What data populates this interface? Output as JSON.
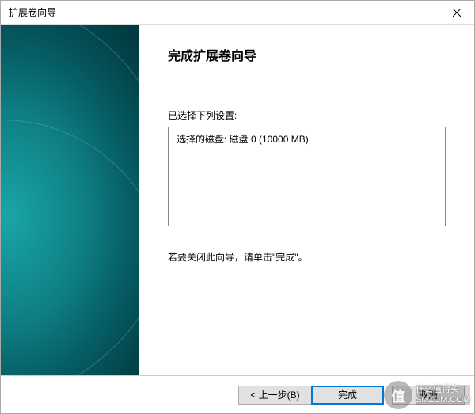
{
  "titlebar": {
    "title": "扩展卷向导"
  },
  "content": {
    "heading": "完成扩展卷向导",
    "settings_label": "已选择下列设置:",
    "settings_text": "选择的磁盘: 磁盘 0 (10000 MB)",
    "instruction": "若要关闭此向导，请单击\"完成\"。"
  },
  "footer": {
    "back": "< 上一步(B)",
    "finish": "完成",
    "cancel": "取消"
  },
  "watermark": {
    "badge": "值",
    "line1": "什么值得买",
    "line2": "SMZDM.COM"
  }
}
